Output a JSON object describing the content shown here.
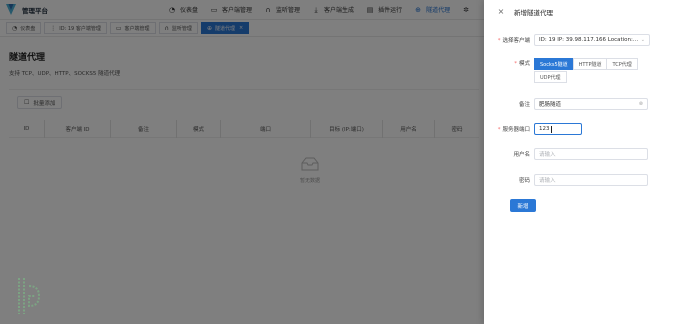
{
  "header": {
    "brand": "管理平台",
    "nav": [
      {
        "label": "仪表盘",
        "icon": "dashboard-icon",
        "active": false
      },
      {
        "label": "客户端管理",
        "icon": "monitor-icon",
        "active": false
      },
      {
        "label": "监听管理",
        "icon": "headset-icon",
        "active": false
      },
      {
        "label": "客户端生成",
        "icon": "download-icon",
        "active": false
      },
      {
        "label": "插件运行",
        "icon": "document-icon",
        "active": false
      },
      {
        "label": "隧道代理",
        "icon": "globe-icon",
        "active": true
      }
    ]
  },
  "tags": [
    {
      "label": "仪表盘",
      "icon": "dashboard-icon",
      "active": false
    },
    {
      "label": "ID: 19 客户端管理",
      "icon": "grip-icon",
      "active": false
    },
    {
      "label": "客户端管理",
      "icon": "monitor-icon",
      "active": false
    },
    {
      "label": "监听管理",
      "icon": "headset-icon",
      "active": false
    },
    {
      "label": "隧道代理",
      "icon": "globe-icon",
      "active": true,
      "close": "×"
    }
  ],
  "page": {
    "title": "隧道代理",
    "description": "支持 TCP、UDP、HTTP、SOCKS5 隧道代理",
    "add_button": "批量添加",
    "columns": [
      "ID",
      "客户端 ID",
      "备注",
      "模式",
      "端口",
      "目标 (IP:端口)",
      "用户名",
      "密码"
    ],
    "empty_text": "暂无数据"
  },
  "drawer": {
    "title": "新增隧道代理",
    "close_glyph": "×",
    "client": {
      "label": "选择客户端",
      "value": "ID: 19 IP: 39.98.117.166 Location:..."
    },
    "mode": {
      "label": "模式",
      "options": [
        "Socks5隧道",
        "HTTP隧道",
        "TCP代理",
        "UDP代理"
      ],
      "selected": "Socks5隧道"
    },
    "remark": {
      "label": "备注",
      "value": "肥肠隧道"
    },
    "port": {
      "label": "服务器端口",
      "value": "123"
    },
    "username": {
      "label": "用户名",
      "placeholder": "请输入"
    },
    "password": {
      "label": "密码",
      "placeholder": "请输入"
    },
    "submit": "新增"
  },
  "colors": {
    "accent": "#2b78d6",
    "mask": "rgba(0,0,0,0.5)"
  }
}
